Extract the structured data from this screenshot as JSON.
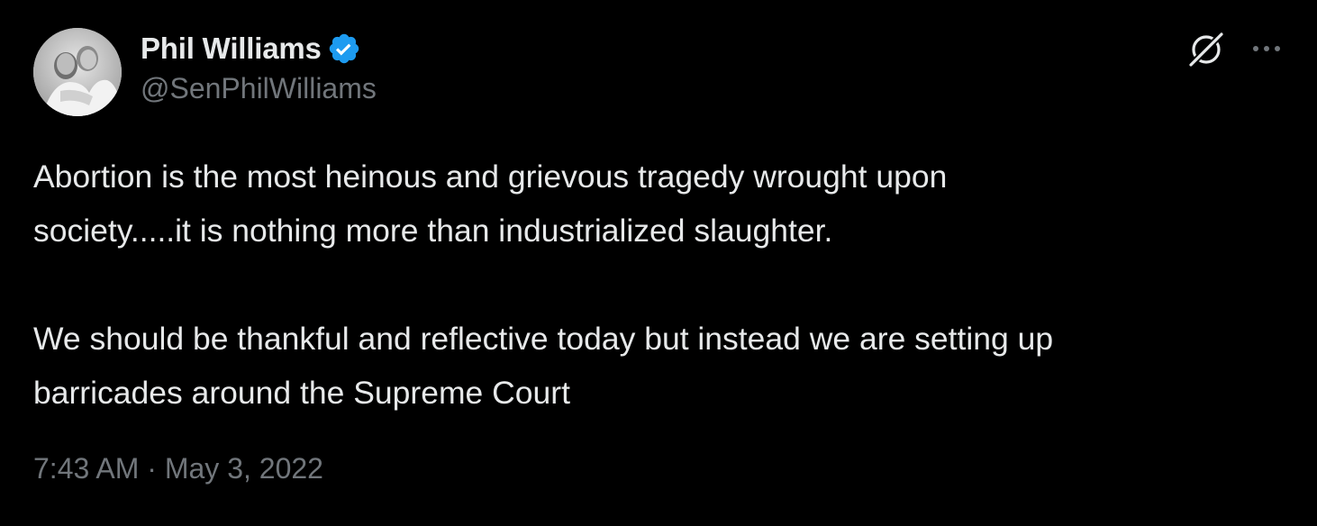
{
  "tweet": {
    "author": {
      "display_name": "Phil Williams",
      "handle": "@SenPhilWilliams",
      "verified_icon": "verified-badge-icon",
      "avatar_icon": "profile-photo"
    },
    "actions": {
      "grok_icon": "grok-icon",
      "more_icon": "more-options-icon"
    },
    "text": {
      "line1": "Abortion is the most heinous and grievous tragedy wrought upon",
      "line2": "society.....it is nothing more than industrialized slaughter.",
      "line3": "We should be thankful and reflective today but instead we are setting up",
      "line4": "barricades around the Supreme Court"
    },
    "timestamp": "7:43 AM · May 3, 2022"
  },
  "colors": {
    "background": "#000000",
    "primary_text": "#e7e9ea",
    "secondary_text": "#71767b",
    "verified_blue": "#1d9bf0"
  }
}
